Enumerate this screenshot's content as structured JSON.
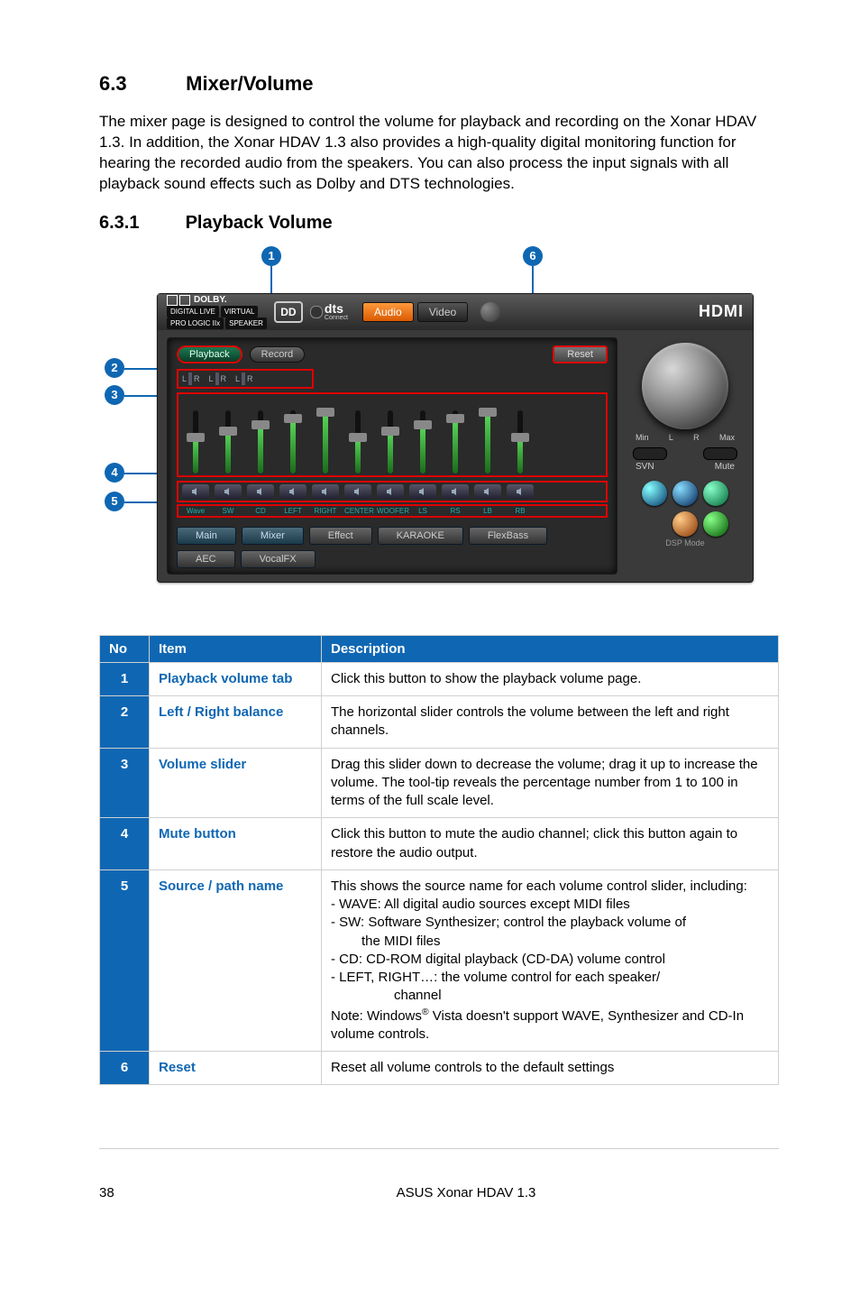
{
  "section": {
    "number": "6.3",
    "title": "Mixer/Volume"
  },
  "intro": "The mixer page is designed to control the volume for playback and recording on the Xonar HDAV 1.3. In addition, the Xonar HDAV 1.3 also provides a high-quality digital monitoring function for hearing the recorded audio from the speakers. You can also process the input signals with all playback sound effects such as Dolby and DTS technologies.",
  "subsection": {
    "number": "6.3.1",
    "title": "Playback Volume"
  },
  "callouts": {
    "c1": "1",
    "c2": "2",
    "c3": "3",
    "c4": "4",
    "c5": "5",
    "c6": "6"
  },
  "app": {
    "dolby_top": "DOLBY.",
    "badge1": "DIGITAL LIVE",
    "badge2": "PRO LOGIC IIx",
    "badge3": "VIRTUAL",
    "badge4": "SPEAKER",
    "round_badge": "DD",
    "dts": "dts",
    "dts_sub": "Connect",
    "audio_btn": "Audio",
    "video_btn": "Video",
    "hdmi": "HDMI",
    "tabs": {
      "playback": "Playback",
      "record": "Record",
      "reset": "Reset"
    },
    "balance_letters": [
      "L",
      "R",
      "L",
      "R",
      "L",
      "R"
    ],
    "source_names": [
      "Wave",
      "SW",
      "CD",
      "LEFT",
      "RIGHT",
      "CENTER",
      "WOOFER",
      "LS",
      "RS",
      "LB",
      "RB"
    ],
    "bottom_tabs": [
      "Main",
      "Mixer",
      "Effect",
      "KARAOKE",
      "FlexBass",
      "AEC",
      "VocalFX"
    ],
    "knob": {
      "min": "Min",
      "max": "Max",
      "left": "L",
      "right": "R",
      "svn": "SVN",
      "mute": "Mute",
      "dsp": "DSP Mode"
    }
  },
  "table": {
    "headers": {
      "no": "No",
      "item": "Item",
      "desc": "Description"
    },
    "rows": [
      {
        "no": "1",
        "item": "Playback volume tab",
        "desc": "Click this button to show the playback volume page."
      },
      {
        "no": "2",
        "item": "Left / Right balance",
        "desc": "The horizontal slider controls the volume between the left and right channels."
      },
      {
        "no": "3",
        "item": "Volume slider",
        "desc": "Drag this slider down to decrease the volume; drag it up to increase the volume. The tool-tip reveals the percentage number from 1 to 100 in terms of the full scale level."
      },
      {
        "no": "4",
        "item": "Mute button",
        "desc": "Click this button to mute the audio channel; click this button again to restore the audio output."
      },
      {
        "no": "5",
        "item": "Source / path name",
        "desc_lines": [
          "This shows the source name for each volume control slider, including:",
          "- WAVE: All digital audio sources except MIDI files",
          "- SW: Software Synthesizer; control the playback volume of the MIDI files",
          "- CD: CD-ROM digital playback (CD-DA) volume control",
          "- LEFT, RIGHT…: the volume control for each speaker/ channel",
          "Note: Windows® Vista doesn't support WAVE, Synthesizer and CD-In volume controls."
        ]
      },
      {
        "no": "6",
        "item": "Reset",
        "desc": "Reset all volume controls to the default settings"
      }
    ]
  },
  "footer": {
    "page": "38",
    "doc": "ASUS Xonar HDAV 1.3"
  }
}
